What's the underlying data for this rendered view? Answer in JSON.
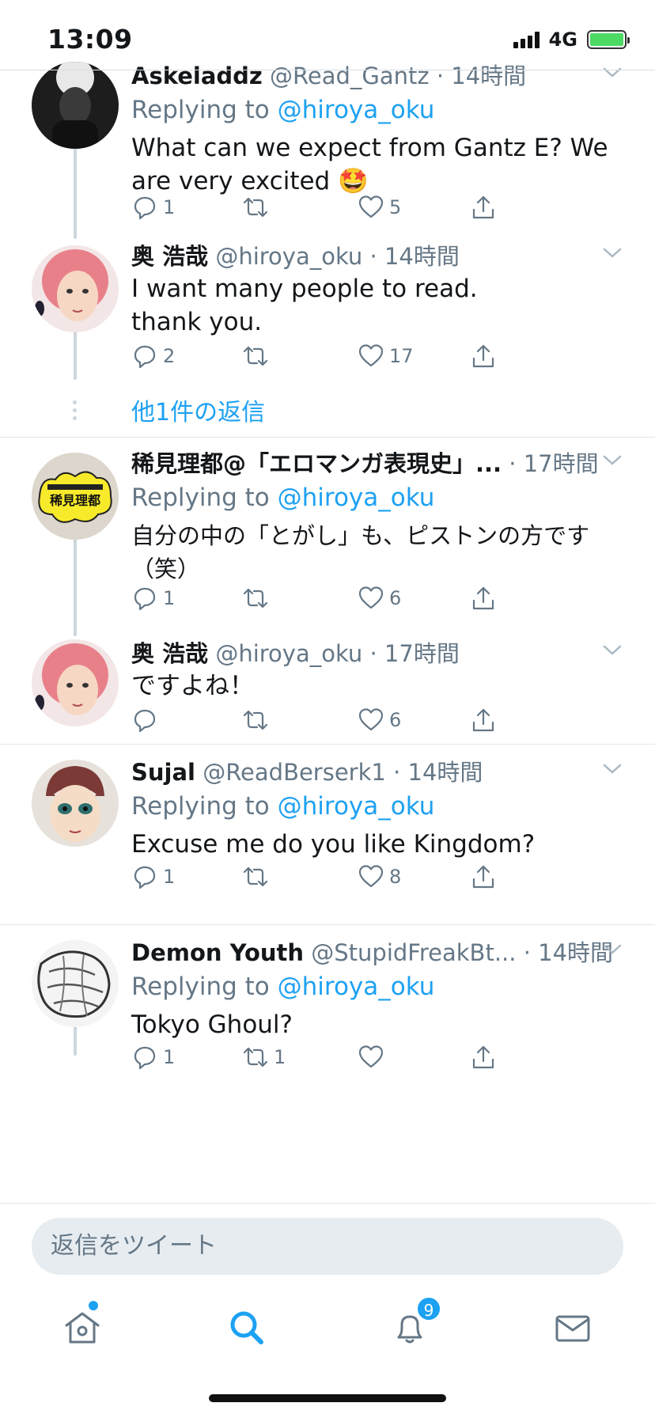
{
  "status_bar": {
    "time": "13:09",
    "network": "4G"
  },
  "tweets": [
    {
      "name": "Askeladdz",
      "handle": "@Read_Gantz",
      "time": "· 14時間",
      "replying_label": "Replying to",
      "replying_to": "@hiroya_oku",
      "text": "What can we expect from Gantz E? We are very excited 🤩",
      "replies": "1",
      "retweets": "",
      "likes": "5"
    },
    {
      "name": "奥 浩哉",
      "handle": "@hiroya_oku",
      "time": "· 14時間",
      "text": "I want many people to read.\nthank you.",
      "replies": "2",
      "retweets": "",
      "likes": "17"
    },
    {
      "name": "稀見理都@「エロマンガ表現史」...",
      "handle": "",
      "time": "· 17時間",
      "replying_label": "Replying to",
      "replying_to": "@hiroya_oku",
      "text": "自分の中の「とがし」も、ピストンの方です（笑）",
      "replies": "1",
      "retweets": "",
      "likes": "6"
    },
    {
      "name": "奥 浩哉",
      "handle": "@hiroya_oku",
      "time": "· 17時間",
      "text": "ですよね！",
      "replies": "",
      "retweets": "",
      "likes": "6"
    },
    {
      "name": "Sujal",
      "handle": "@ReadBerserk1",
      "time": "· 14時間",
      "replying_label": "Replying to",
      "replying_to": "@hiroya_oku",
      "text": "Excuse me do you like Kingdom?",
      "replies": "1",
      "retweets": "",
      "likes": "8"
    },
    {
      "name": "Demon Youth",
      "handle": "@StupidFreakBt...",
      "time": "· 14時間",
      "replying_label": "Replying to",
      "replying_to": "@hiroya_oku",
      "text": "Tokyo Ghoul?",
      "replies": "1",
      "retweets": "1",
      "likes": ""
    }
  ],
  "more_replies": "他1件の返信",
  "reply_bar": {
    "placeholder": "返信をツイート"
  },
  "tabbar": {
    "notifications_badge": "9"
  },
  "colors": {
    "accent": "#1da1f2",
    "secondary_text": "#657786",
    "separator": "#e1e8ed"
  },
  "icons": [
    "reply-icon",
    "retweet-icon",
    "like-icon",
    "share-icon",
    "chevron-down-icon",
    "home-icon",
    "search-icon",
    "bell-icon",
    "mail-icon"
  ]
}
